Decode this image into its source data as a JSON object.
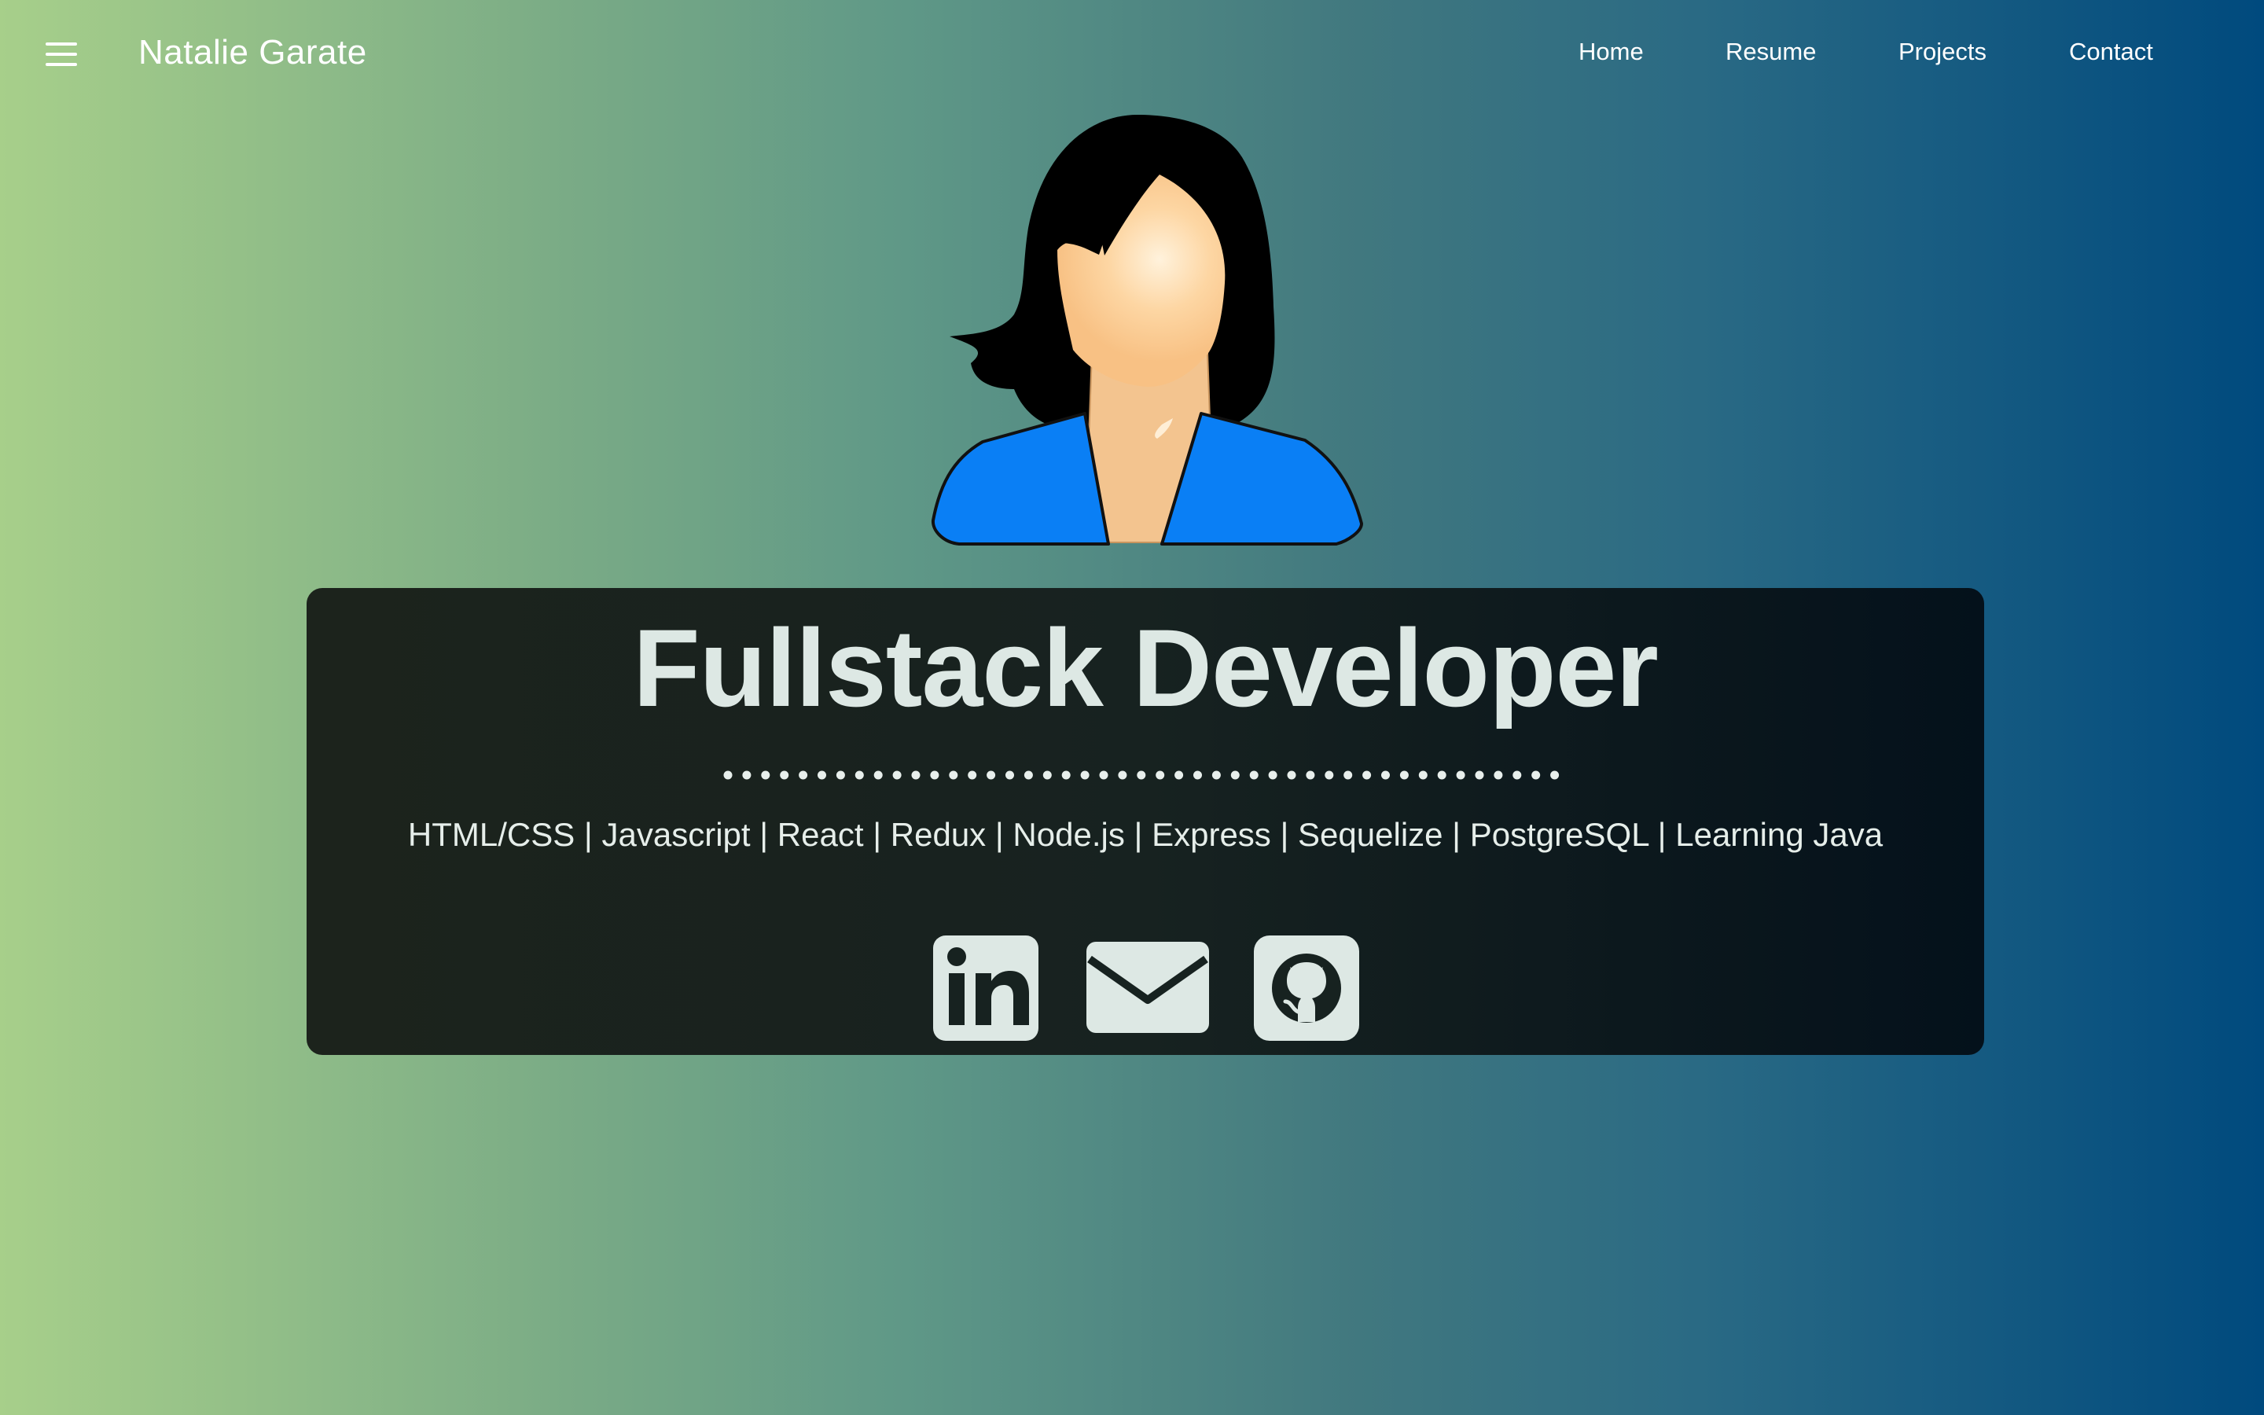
{
  "navbar": {
    "brand": "Natalie Garate",
    "links": [
      "Home",
      "Resume",
      "Projects",
      "Contact"
    ]
  },
  "hero": {
    "title": "Fullstack Developer",
    "skills": "HTML/CSS | Javascript | React | Redux | Node.js | Express | Sequelize | PostgreSQL | Learning Java"
  },
  "social": {
    "icons": [
      "linkedin-icon",
      "email-icon",
      "github-icon"
    ]
  },
  "colors": {
    "gradient_left": "#a7cf8a",
    "gradient_right": "#004a7e",
    "card_bg": "#172220",
    "text_light": "#dde8e4",
    "shirt_blue": "#0a7ff5",
    "skin": "#fccb90"
  }
}
